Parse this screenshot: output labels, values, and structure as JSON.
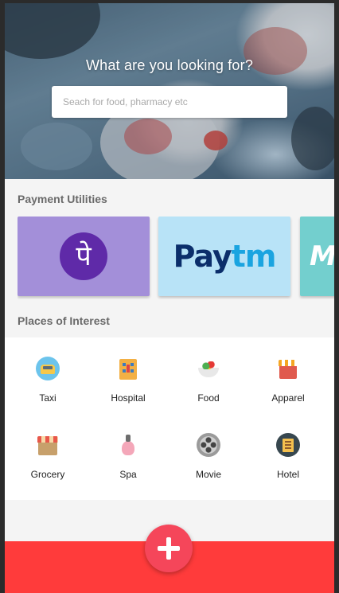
{
  "hero": {
    "title": "What are you looking for?",
    "search_placeholder": "Seach for food, pharmacy etc"
  },
  "payment": {
    "heading": "Payment Utilities",
    "cards": [
      {
        "name": "PhonePe",
        "logo_text": "पे",
        "color": "#a38fd9"
      },
      {
        "name": "Paytm",
        "logo_pay": "Pay",
        "logo_tm": "tm",
        "color": "#b8e3f7"
      },
      {
        "name": "MobiKwik",
        "logo_text": "M",
        "color": "#73cfce"
      }
    ]
  },
  "places": {
    "heading": "Places of Interest",
    "items": [
      {
        "label": "Taxi",
        "icon": "taxi-icon"
      },
      {
        "label": "Hospital",
        "icon": "hospital-icon"
      },
      {
        "label": "Food",
        "icon": "food-icon"
      },
      {
        "label": "Apparel",
        "icon": "apparel-icon"
      },
      {
        "label": "Grocery",
        "icon": "grocery-icon"
      },
      {
        "label": "Spa",
        "icon": "spa-icon"
      },
      {
        "label": "Movie",
        "icon": "movie-icon"
      },
      {
        "label": "Hotel",
        "icon": "hotel-icon"
      }
    ]
  },
  "bottom": {
    "fab_icon": "plus-icon",
    "bar_color": "#ff3b3b"
  }
}
